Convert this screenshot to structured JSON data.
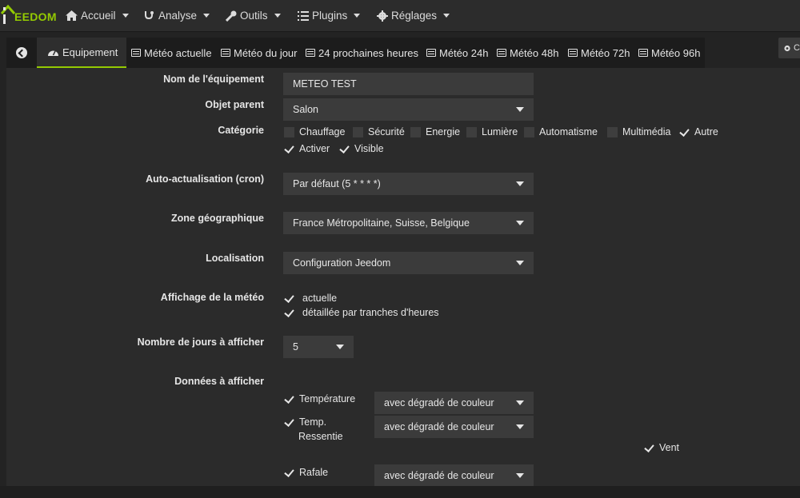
{
  "app": {
    "logo_text": "EEDOM"
  },
  "navbar": {
    "items": [
      {
        "label": "Accueil",
        "icon": "home-icon"
      },
      {
        "label": "Analyse",
        "icon": "stethoscope-icon"
      },
      {
        "label": "Outils",
        "icon": "wrench-icon"
      },
      {
        "label": "Plugins",
        "icon": "list-icon"
      },
      {
        "label": "Réglages",
        "icon": "gear-icon"
      }
    ]
  },
  "tabs": [
    {
      "label": "Equipement",
      "icon": "dashboard-icon",
      "active": true
    },
    {
      "label": "Météo actuelle",
      "icon": "list-alt-icon"
    },
    {
      "label": "Météo du jour",
      "icon": "list-alt-icon"
    },
    {
      "label": "24 prochaines heures",
      "icon": "list-alt-icon"
    },
    {
      "label": "Météo 24h",
      "icon": "list-alt-icon"
    },
    {
      "label": "Météo 48h",
      "icon": "list-alt-icon"
    },
    {
      "label": "Météo 72h",
      "icon": "list-alt-icon"
    },
    {
      "label": "Météo 96h",
      "icon": "list-alt-icon"
    }
  ],
  "right_button": {
    "label": "C"
  },
  "form": {
    "name": {
      "label": "Nom de l'équipement",
      "value": "METEO TEST"
    },
    "parent": {
      "label": "Objet parent",
      "value": "Salon"
    },
    "category": {
      "label": "Catégorie",
      "options": [
        {
          "label": "Chauffage",
          "checked": false
        },
        {
          "label": "Sécurité",
          "checked": false
        },
        {
          "label": "Energie",
          "checked": false
        },
        {
          "label": "Lumière",
          "checked": false
        },
        {
          "label": "Automatisme",
          "checked": false
        },
        {
          "label": "Multimédia",
          "checked": false
        },
        {
          "label": "Autre",
          "checked": true
        }
      ],
      "activate": {
        "label": "Activer",
        "checked": true
      },
      "visible": {
        "label": "Visible",
        "checked": true
      }
    },
    "cron": {
      "label": "Auto-actualisation (cron)",
      "value": "Par défaut (5 * * * *)"
    },
    "zone": {
      "label": "Zone géographique",
      "value": "France Métropolitaine, Suisse, Belgique"
    },
    "location": {
      "label": "Localisation",
      "value": "Configuration Jeedom"
    },
    "display": {
      "label": "Affichage de la météo",
      "current": {
        "label": "actuelle",
        "checked": true
      },
      "hourly": {
        "label": "détaillée par tranches d'heures",
        "checked": true
      }
    },
    "days": {
      "label": "Nombre de jours à afficher",
      "value": "5"
    },
    "data": {
      "label": "Données à afficher",
      "temperature": {
        "label": "Température",
        "checked": true,
        "mode": "avec dégradé de couleur"
      },
      "feels_like": {
        "label_line1": "Temp.",
        "label_line2": "Ressentie",
        "checked": true,
        "mode": "avec dégradé de couleur"
      },
      "wind": {
        "label": "Vent",
        "checked": true
      },
      "gust": {
        "label": "Rafale",
        "checked": true,
        "mode": "avec dégradé de couleur"
      }
    }
  }
}
